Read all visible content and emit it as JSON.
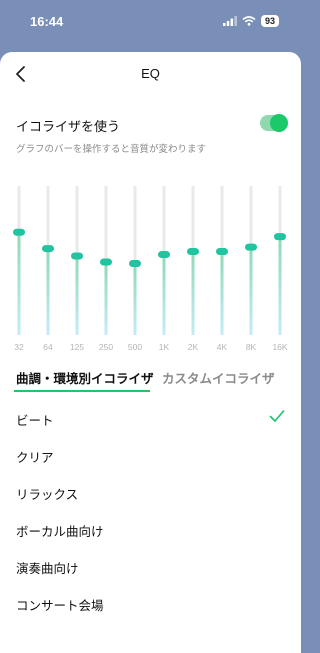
{
  "status": {
    "time": "16:44",
    "battery": "93"
  },
  "header": {
    "title": "EQ"
  },
  "equalizer": {
    "label": "イコライザを使う",
    "enabled": true,
    "description": "グラフのバーを操作すると音質が変わります",
    "bands": [
      {
        "freq": "32",
        "level": 0.69
      },
      {
        "freq": "64",
        "level": 0.58
      },
      {
        "freq": "125",
        "level": 0.53
      },
      {
        "freq": "250",
        "level": 0.49
      },
      {
        "freq": "500",
        "level": 0.48
      },
      {
        "freq": "1K",
        "level": 0.54
      },
      {
        "freq": "2K",
        "level": 0.56
      },
      {
        "freq": "4K",
        "level": 0.56
      },
      {
        "freq": "8K",
        "level": 0.59
      },
      {
        "freq": "16K",
        "level": 0.66
      }
    ],
    "colors": {
      "accent": "#1bc86a",
      "track": "#e9e9e9",
      "knob": "#22c3a0",
      "fill_top": "#8fd9b6",
      "fill_bottom": "#c5ebf7"
    }
  },
  "tabs": [
    {
      "label": "曲調・環境別イコライザ",
      "active": true
    },
    {
      "label": "カスタムイコライザ",
      "active": false
    }
  ],
  "presets": [
    {
      "label": "ビート",
      "selected": true
    },
    {
      "label": "クリア",
      "selected": false
    },
    {
      "label": "リラックス",
      "selected": false
    },
    {
      "label": "ボーカル曲向け",
      "selected": false
    },
    {
      "label": "演奏曲向け",
      "selected": false
    },
    {
      "label": "コンサート会場",
      "selected": false
    }
  ]
}
